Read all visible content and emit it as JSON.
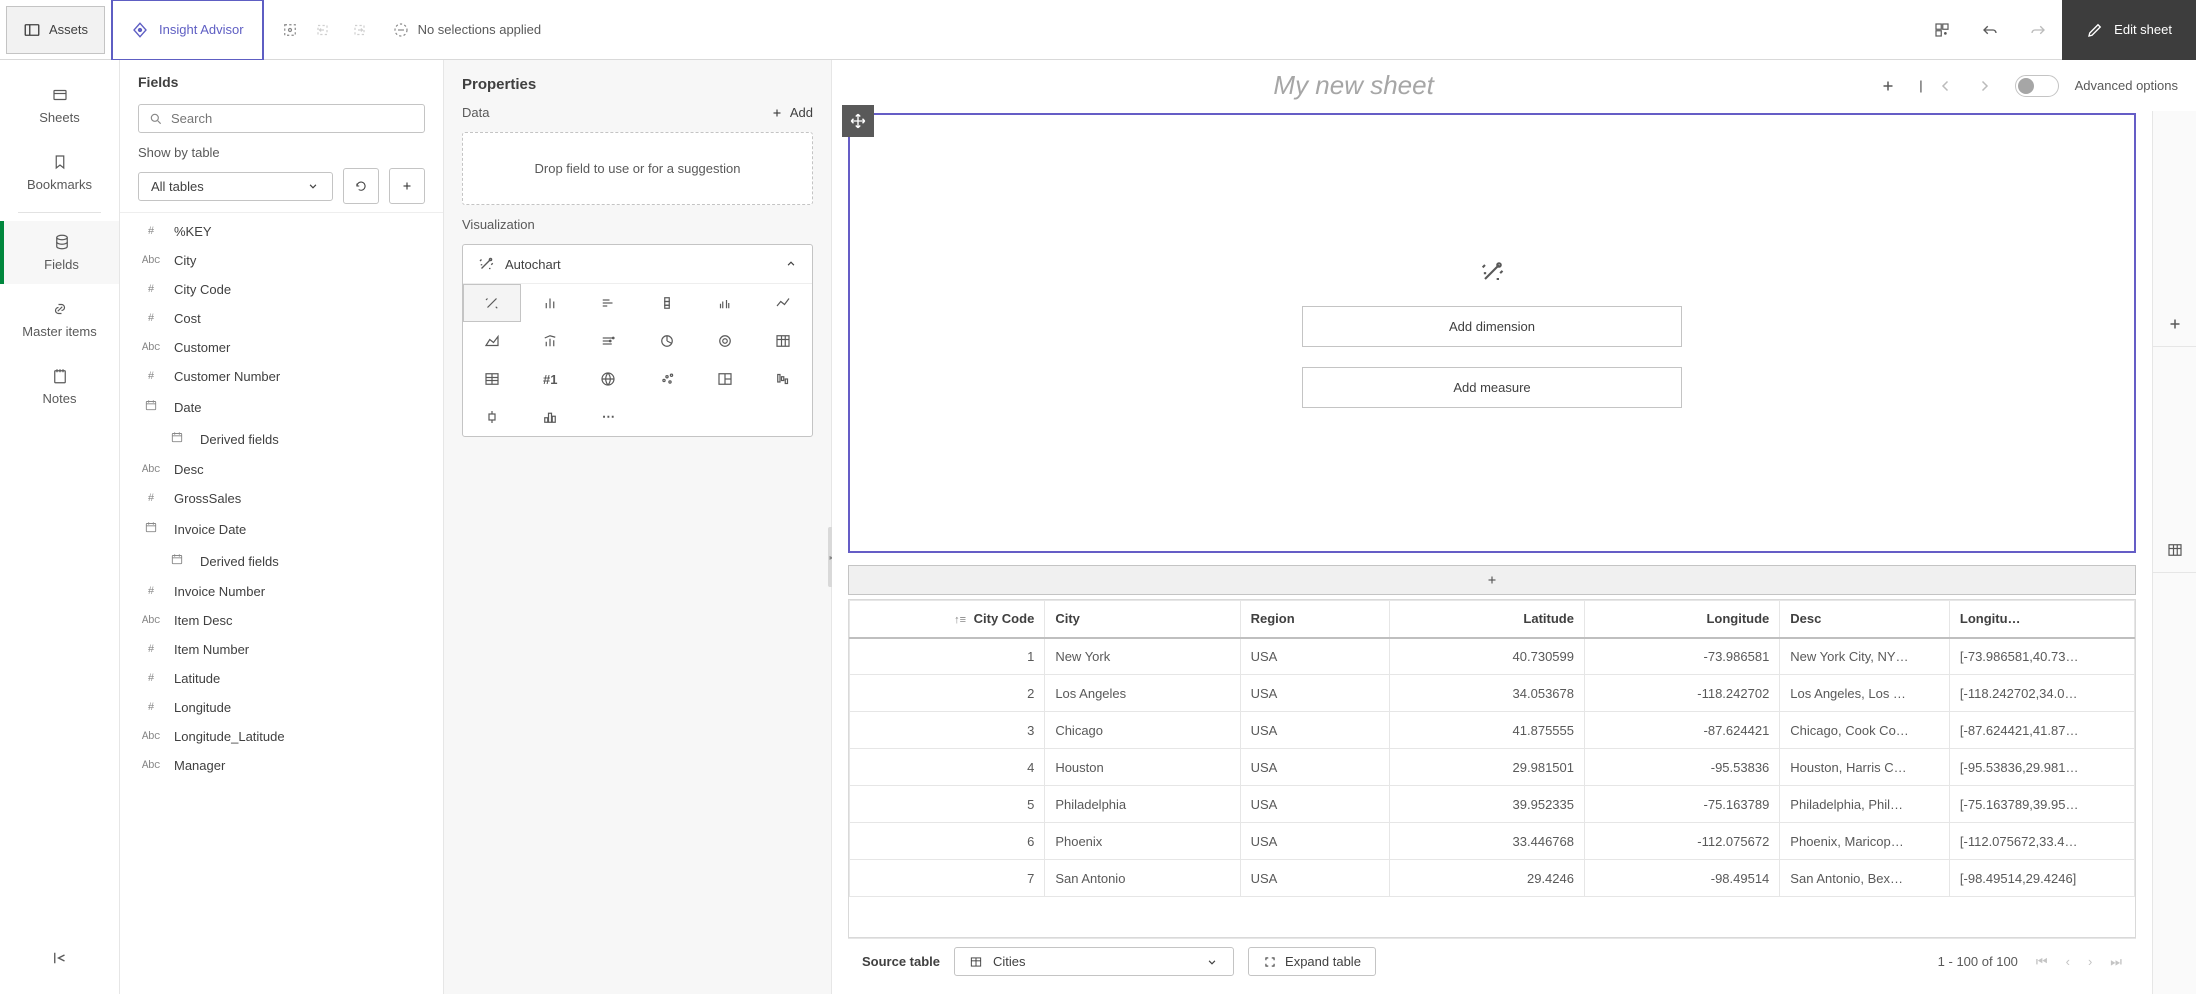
{
  "topbar": {
    "assets": "Assets",
    "insight": "Insight Advisor",
    "no_selections": "No selections applied",
    "edit_sheet": "Edit sheet"
  },
  "rail": {
    "sheets": "Sheets",
    "bookmarks": "Bookmarks",
    "fields": "Fields",
    "master_items": "Master items",
    "notes": "Notes"
  },
  "fields_panel": {
    "title": "Fields",
    "search_placeholder": "Search",
    "show_by": "Show by table",
    "all_tables": "All tables",
    "fields": [
      {
        "type": "#",
        "name": "%KEY"
      },
      {
        "type": "Abc",
        "name": "City"
      },
      {
        "type": "#",
        "name": "City Code"
      },
      {
        "type": "#",
        "name": "Cost"
      },
      {
        "type": "Abc",
        "name": "Customer"
      },
      {
        "type": "#",
        "name": "Customer Number"
      },
      {
        "type": "date",
        "name": "Date"
      },
      {
        "type": "date",
        "name": "Derived fields",
        "indent": true
      },
      {
        "type": "Abc",
        "name": "Desc"
      },
      {
        "type": "#",
        "name": "GrossSales"
      },
      {
        "type": "date",
        "name": "Invoice Date"
      },
      {
        "type": "date",
        "name": "Derived fields",
        "indent": true
      },
      {
        "type": "#",
        "name": "Invoice Number"
      },
      {
        "type": "Abc",
        "name": "Item Desc"
      },
      {
        "type": "#",
        "name": "Item Number"
      },
      {
        "type": "#",
        "name": "Latitude"
      },
      {
        "type": "#",
        "name": "Longitude"
      },
      {
        "type": "Abc",
        "name": "Longitude_Latitude"
      },
      {
        "type": "Abc",
        "name": "Manager"
      }
    ]
  },
  "properties": {
    "title": "Properties",
    "data": "Data",
    "add": "Add",
    "drop_hint": "Drop field to use or for a suggestion",
    "visualization": "Visualization",
    "vis_name": "Autochart"
  },
  "canvas": {
    "sheet_title": "My new sheet",
    "advanced_options": "Advanced options",
    "add_dimension": "Add dimension",
    "add_measure": "Add measure"
  },
  "table": {
    "headers": [
      "City Code",
      "City",
      "Region",
      "Latitude",
      "Longitude",
      "Desc",
      "Longitu…"
    ],
    "rows": [
      {
        "code": "1",
        "city": "New York",
        "region": "USA",
        "lat": "40.730599",
        "lng": "-73.986581",
        "desc": "New York City, NY…",
        "ll": "[-73.986581,40.73…"
      },
      {
        "code": "2",
        "city": "Los Angeles",
        "region": "USA",
        "lat": "34.053678",
        "lng": "-118.242702",
        "desc": "Los Angeles, Los …",
        "ll": "[-118.242702,34.0…"
      },
      {
        "code": "3",
        "city": "Chicago",
        "region": "USA",
        "lat": "41.875555",
        "lng": "-87.624421",
        "desc": "Chicago, Cook Co…",
        "ll": "[-87.624421,41.87…"
      },
      {
        "code": "4",
        "city": "Houston",
        "region": "USA",
        "lat": "29.981501",
        "lng": "-95.53836",
        "desc": "Houston, Harris C…",
        "ll": "[-95.53836,29.981…"
      },
      {
        "code": "5",
        "city": "Philadelphia",
        "region": "USA",
        "lat": "39.952335",
        "lng": "-75.163789",
        "desc": "Philadelphia, Phil…",
        "ll": "[-75.163789,39.95…"
      },
      {
        "code": "6",
        "city": "Phoenix",
        "region": "USA",
        "lat": "33.446768",
        "lng": "-112.075672",
        "desc": "Phoenix, Maricop…",
        "ll": "[-112.075672,33.4…"
      },
      {
        "code": "7",
        "city": "San Antonio",
        "region": "USA",
        "lat": "29.4246",
        "lng": "-98.49514",
        "desc": "San Antonio, Bex…",
        "ll": "[-98.49514,29.4246]"
      }
    ],
    "source_label": "Source table",
    "source_value": "Cities",
    "expand": "Expand table",
    "pager": "1 - 100 of 100"
  }
}
